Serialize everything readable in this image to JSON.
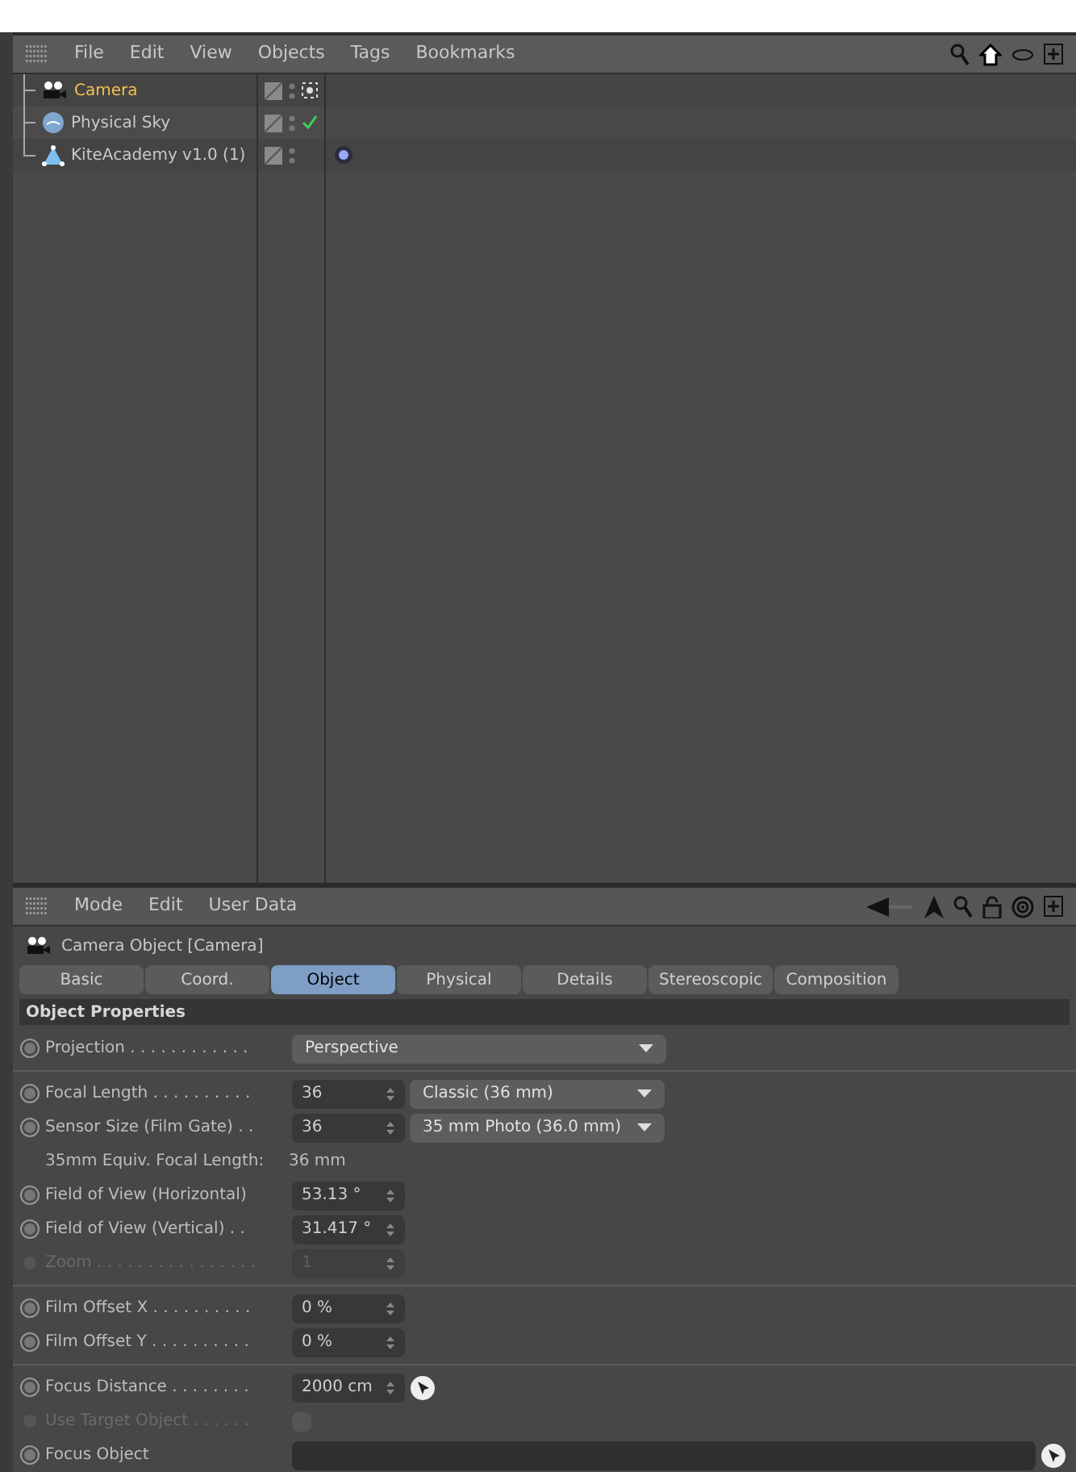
{
  "object_manager": {
    "menu": [
      "File",
      "Edit",
      "View",
      "Objects",
      "Tags",
      "Bookmarks"
    ],
    "objects": [
      {
        "name": "Camera",
        "kind": "camera",
        "selected": true,
        "tags": [
          {
            "kind": "target"
          }
        ]
      },
      {
        "name": "Physical Sky",
        "kind": "sky",
        "selected": false,
        "tags": [
          {
            "kind": "check"
          }
        ]
      },
      {
        "name": "KiteAcademy v1.0 (1)",
        "kind": "mesh",
        "selected": false,
        "tags": [
          {
            "kind": "material"
          }
        ]
      }
    ]
  },
  "attribute_manager": {
    "menu": [
      "Mode",
      "Edit",
      "User Data"
    ],
    "title": "Camera Object [Camera]",
    "tabs": [
      {
        "label": "Basic",
        "selected": false
      },
      {
        "label": "Coord.",
        "selected": false
      },
      {
        "label": "Object",
        "selected": true
      },
      {
        "label": "Physical",
        "selected": false
      },
      {
        "label": "Details",
        "selected": false
      },
      {
        "label": "Stereoscopic",
        "selected": false
      },
      {
        "label": "Composition",
        "selected": false
      }
    ],
    "section": "Object Properties",
    "groups": [
      [
        {
          "kind": "dropdown",
          "label": "Projection . . . . . . . . . . . .",
          "value": "Perspective",
          "disabled": false
        }
      ],
      [
        {
          "kind": "number_dropdown",
          "label": "Focal Length . . . . . . . . . .",
          "value": "36",
          "option": "Classic (36 mm)",
          "disabled": false
        },
        {
          "kind": "number_dropdown",
          "label": "Sensor Size (Film Gate) . .",
          "value": "36",
          "option": "35 mm Photo (36.0 mm)",
          "disabled": false
        },
        {
          "kind": "info",
          "label": "35mm Equiv. Focal Length:",
          "value": "36 mm"
        },
        {
          "kind": "number",
          "label": "Field of View (Horizontal)",
          "value": "53.13 °",
          "disabled": false
        },
        {
          "kind": "number",
          "label": "Field of View (Vertical) . .",
          "value": "31.417 °",
          "disabled": false
        },
        {
          "kind": "number",
          "label": "Zoom . . . . . . . . . . . . . . . .",
          "value": "1",
          "disabled": true
        }
      ],
      [
        {
          "kind": "number",
          "label": "Film Offset X . . . . . . . . . .",
          "value": "0 %",
          "disabled": false
        },
        {
          "kind": "number",
          "label": "Film Offset Y . . . . . . . . . .",
          "value": "0 %",
          "disabled": false
        }
      ],
      [
        {
          "kind": "number_pick",
          "label": "Focus Distance . . . . . . . .",
          "value": "2000 cm",
          "disabled": false
        },
        {
          "kind": "checkbox",
          "label": "Use Target Object . . . . . .",
          "checked": false,
          "disabled": true
        },
        {
          "kind": "link",
          "label": "Focus Object",
          "disabled": false
        }
      ]
    ]
  }
}
